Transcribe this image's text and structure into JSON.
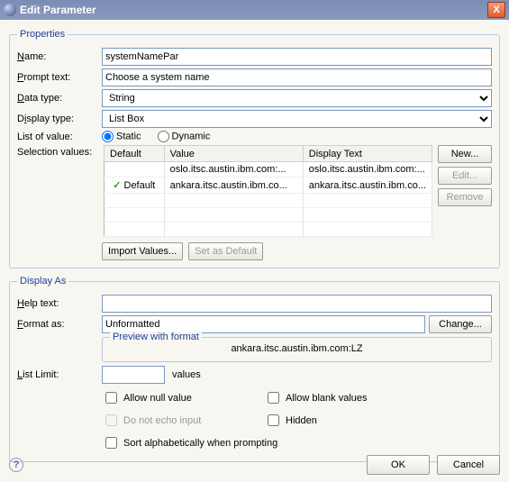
{
  "window": {
    "title": "Edit Parameter",
    "close": "X"
  },
  "properties": {
    "legend": "Properties",
    "name_label": "Name:",
    "name_value": "systemNamePar",
    "prompt_label": "Prompt text:",
    "prompt_value": "Choose a system name",
    "datatype_label": "Data type:",
    "datatype_value": "String",
    "displaytype_label": "Display type:",
    "displaytype_value": "List Box",
    "listofvalue_label": "List of value:",
    "static_label": "Static",
    "dynamic_label": "Dynamic",
    "selection_label": "Selection values:",
    "cols": {
      "default": "Default",
      "value": "Value",
      "display": "Display Text"
    },
    "rows": [
      {
        "default": "",
        "value": "oslo.itsc.austin.ibm.com:...",
        "display": "oslo.itsc.austin.ibm.com:..."
      },
      {
        "default": "Default",
        "value": "ankara.itsc.austin.ibm.co...",
        "display": "ankara.itsc.austin.ibm.co..."
      }
    ],
    "btns": {
      "new": "New...",
      "edit": "Edit...",
      "remove": "Remove",
      "import": "Import Values...",
      "setdefault": "Set as Default"
    }
  },
  "displayas": {
    "legend": "Display As",
    "help_label": "Help text:",
    "help_value": "",
    "format_label": "Format as:",
    "format_value": "Unformatted",
    "change_btn": "Change...",
    "preview_legend": "Preview with format",
    "preview_text": "ankara.itsc.austin.ibm.com:LZ",
    "listlimit_label": "List Limit:",
    "listlimit_value": "",
    "values_label": "values",
    "allow_null": "Allow null value",
    "allow_blank": "Allow blank values",
    "no_echo": "Do not echo input",
    "hidden": "Hidden",
    "sort_alpha": "Sort alphabetically when prompting"
  },
  "footer": {
    "help": "?",
    "ok": "OK",
    "cancel": "Cancel"
  }
}
